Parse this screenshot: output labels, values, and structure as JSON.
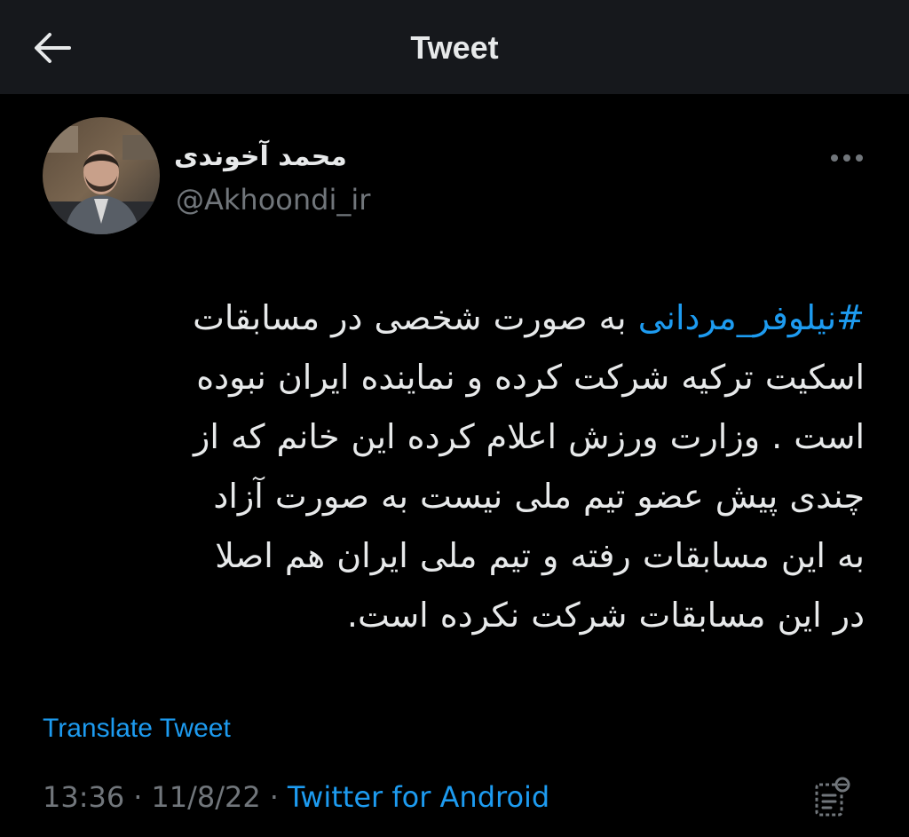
{
  "header": {
    "title": "Tweet",
    "back_icon": "arrow-left-icon"
  },
  "author": {
    "name": "محمد آخوندی",
    "handle": "@Akhoondi_ir",
    "avatar_icon": "profile-photo"
  },
  "tweet": {
    "hashtag": "#نیلوفر_مردانی",
    "lines": [
      " به صورت شخصی در مسابقات",
      "اسکیت ترکیه شرکت کرده و نماینده ایران نبوده",
      "است . وزارت ورزش اعلام کرده این خانم که از",
      "چندی پیش عضو تیم ملی نیست به صورت آزاد",
      "به این مسابقات رفته و  تیم ملی ایران هم اصلا",
      "در این مسابقات شرکت نکرده است."
    ]
  },
  "translate_label": "Translate Tweet",
  "meta": {
    "time": "13:36",
    "date": "11/8/22",
    "separator": "·",
    "source": "Twitter for Android"
  },
  "icons": {
    "more": "more-dots-icon",
    "analytics": "analytics-icon"
  },
  "colors": {
    "background": "#000000",
    "header_background": "#16181c",
    "text": "#e7e9ea",
    "secondary_text": "#71767b",
    "link": "#1d9bf0"
  }
}
